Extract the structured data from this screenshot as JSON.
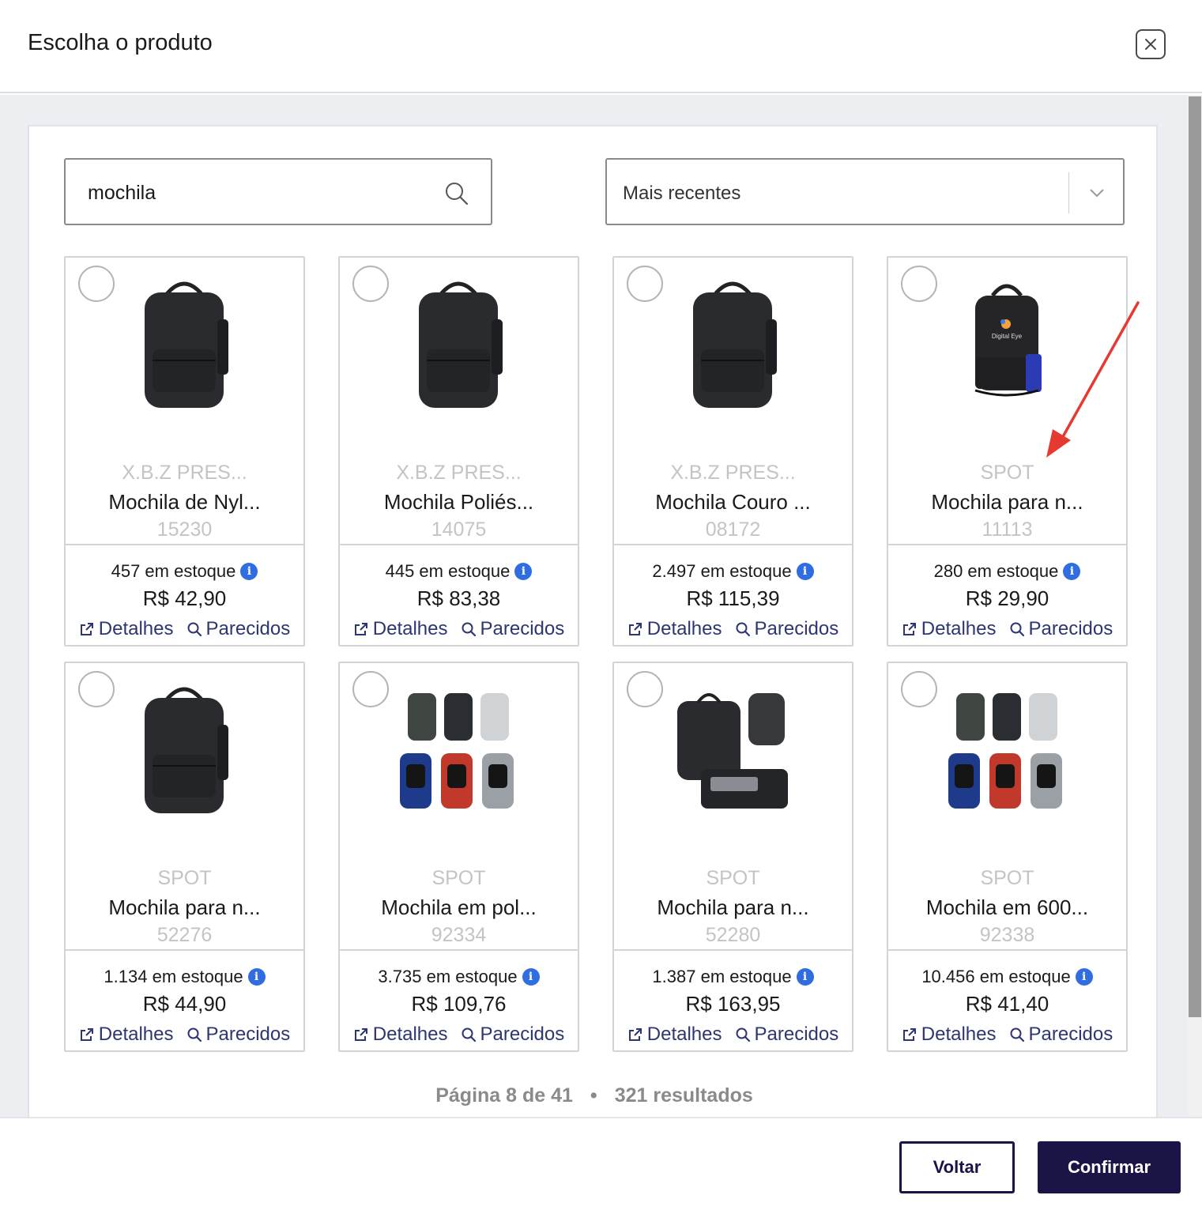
{
  "modal": {
    "title": "Escolha o produto"
  },
  "search": {
    "value": "mochila"
  },
  "sort": {
    "selected": "Mais recentes"
  },
  "products": [
    {
      "brand": "X.B.Z PRES...",
      "name": "Mochila de Nyl...",
      "code": "15230",
      "stock": "457 em estoque",
      "price": "R$ 42,90",
      "image_icon": "black-backpack"
    },
    {
      "brand": "X.B.Z PRES...",
      "name": "Mochila Poliés...",
      "code": "14075",
      "stock": "445 em estoque",
      "price": "R$ 83,38",
      "image_icon": "black-backpack"
    },
    {
      "brand": "X.B.Z PRES...",
      "name": "Mochila Couro ...",
      "code": "08172",
      "stock": "2.497 em estoque",
      "price": "R$ 115,39",
      "image_icon": "black-backpack"
    },
    {
      "brand": "SPOT",
      "name": "Mochila para n...",
      "code": "11113",
      "stock": "280 em estoque",
      "price": "R$ 29,90",
      "image_icon": "black-blue-backpack-with-logo",
      "logo_text": "Digital Eye"
    },
    {
      "brand": "SPOT",
      "name": "Mochila para n...",
      "code": "52276",
      "stock": "1.134 em estoque",
      "price": "R$ 44,90",
      "image_icon": "black-backpack"
    },
    {
      "brand": "SPOT",
      "name": "Mochila em pol...",
      "code": "92334",
      "stock": "3.735 em estoque",
      "price": "R$ 109,76",
      "image_icon": "backpack-color-variants"
    },
    {
      "brand": "SPOT",
      "name": "Mochila para n...",
      "code": "52280",
      "stock": "1.387 em estoque",
      "price": "R$ 163,95",
      "image_icon": "backpack-multiple-views"
    },
    {
      "brand": "SPOT",
      "name": "Mochila em 600...",
      "code": "92338",
      "stock": "10.456 em estoque",
      "price": "R$ 41,40",
      "image_icon": "backpack-color-variants"
    }
  ],
  "card_links": {
    "details": "Detalhes",
    "similar": "Parecidos"
  },
  "pagination": {
    "page": "Página 8 de 41",
    "separator": "•",
    "results": "321 resultados"
  },
  "footer": {
    "back_label": "Voltar",
    "confirm_label": "Confirmar"
  },
  "colors": {
    "primary": "#1b1447",
    "link": "#2d3672",
    "info": "#2f6de1",
    "annotation_arrow": "#e53a2f"
  }
}
